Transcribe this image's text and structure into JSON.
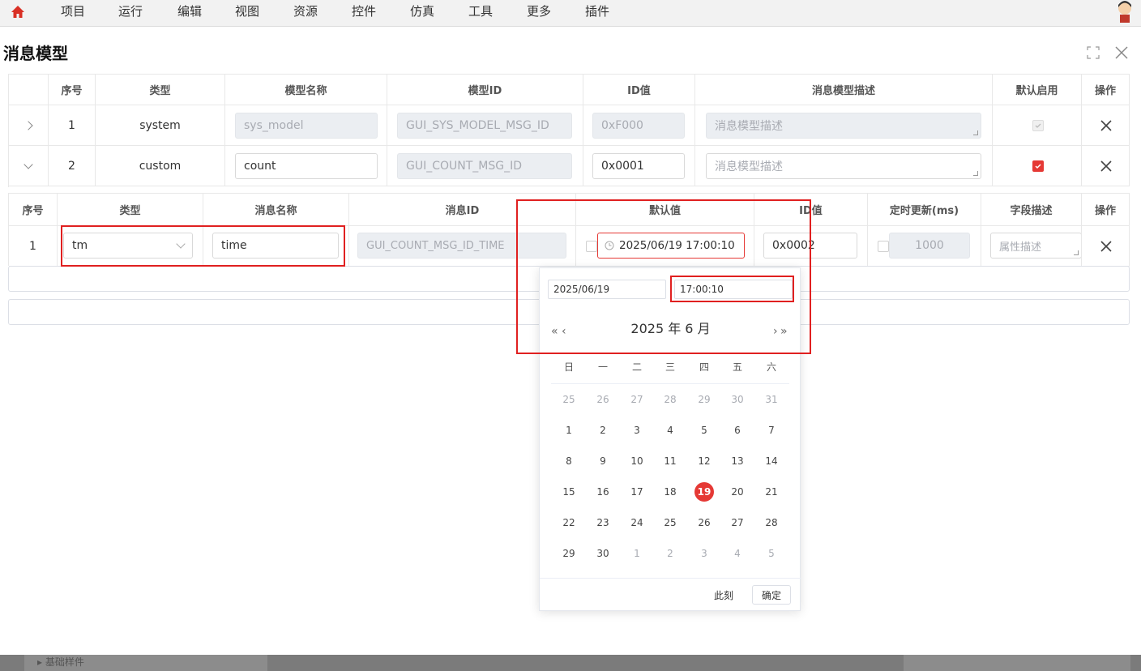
{
  "menu": {
    "items": [
      "项目",
      "运行",
      "编辑",
      "视图",
      "资源",
      "控件",
      "仿真",
      "工具",
      "更多",
      "插件"
    ]
  },
  "dialog": {
    "title": "消息模型"
  },
  "model_table": {
    "headers": [
      "序号",
      "类型",
      "模型名称",
      "模型ID",
      "ID值",
      "消息模型描述",
      "默认启用",
      "操作"
    ],
    "rows": [
      {
        "index": "1",
        "type": "system",
        "name": "sys_model",
        "model_id": "GUI_SYS_MODEL_MSG_ID",
        "id_value": "0xF000",
        "description": "消息模型描述",
        "enabled": true,
        "editable": false
      },
      {
        "index": "2",
        "type": "custom",
        "name": "count",
        "model_id": "GUI_COUNT_MSG_ID",
        "id_value": "0x0001",
        "description": "消息模型描述",
        "enabled": true,
        "editable": true
      }
    ]
  },
  "field_table": {
    "headers": [
      "序号",
      "类型",
      "消息名称",
      "消息ID",
      "默认值",
      "ID值",
      "定时更新(ms)",
      "字段描述",
      "操作"
    ],
    "rows": [
      {
        "index": "1",
        "type": "tm",
        "name": "time",
        "msg_id": "GUI_COUNT_MSG_ID_TIME",
        "default_value": "2025/06/19 17:00:10",
        "id_value": "0x0002",
        "timer": "1000",
        "description_placeholder": "属性描述"
      }
    ]
  },
  "picker": {
    "date": "2025/06/19",
    "time": "17:00:10",
    "title": "2025 年  6 月",
    "weekdays": [
      "日",
      "一",
      "二",
      "三",
      "四",
      "五",
      "六"
    ],
    "weeks": [
      [
        "25",
        "26",
        "27",
        "28",
        "29",
        "30",
        "31"
      ],
      [
        "1",
        "2",
        "3",
        "4",
        "5",
        "6",
        "7"
      ],
      [
        "8",
        "9",
        "10",
        "11",
        "12",
        "13",
        "14"
      ],
      [
        "15",
        "16",
        "17",
        "18",
        "19",
        "20",
        "21"
      ],
      [
        "22",
        "23",
        "24",
        "25",
        "26",
        "27",
        "28"
      ],
      [
        "29",
        "30",
        "1",
        "2",
        "3",
        "4",
        "5"
      ]
    ],
    "selected_day": "19",
    "now_label": "此刻",
    "ok_label": "确定"
  },
  "bottom": {
    "label": "基础样件"
  },
  "colors": {
    "accent": "#e53935",
    "highlight_box": "#e02020"
  }
}
